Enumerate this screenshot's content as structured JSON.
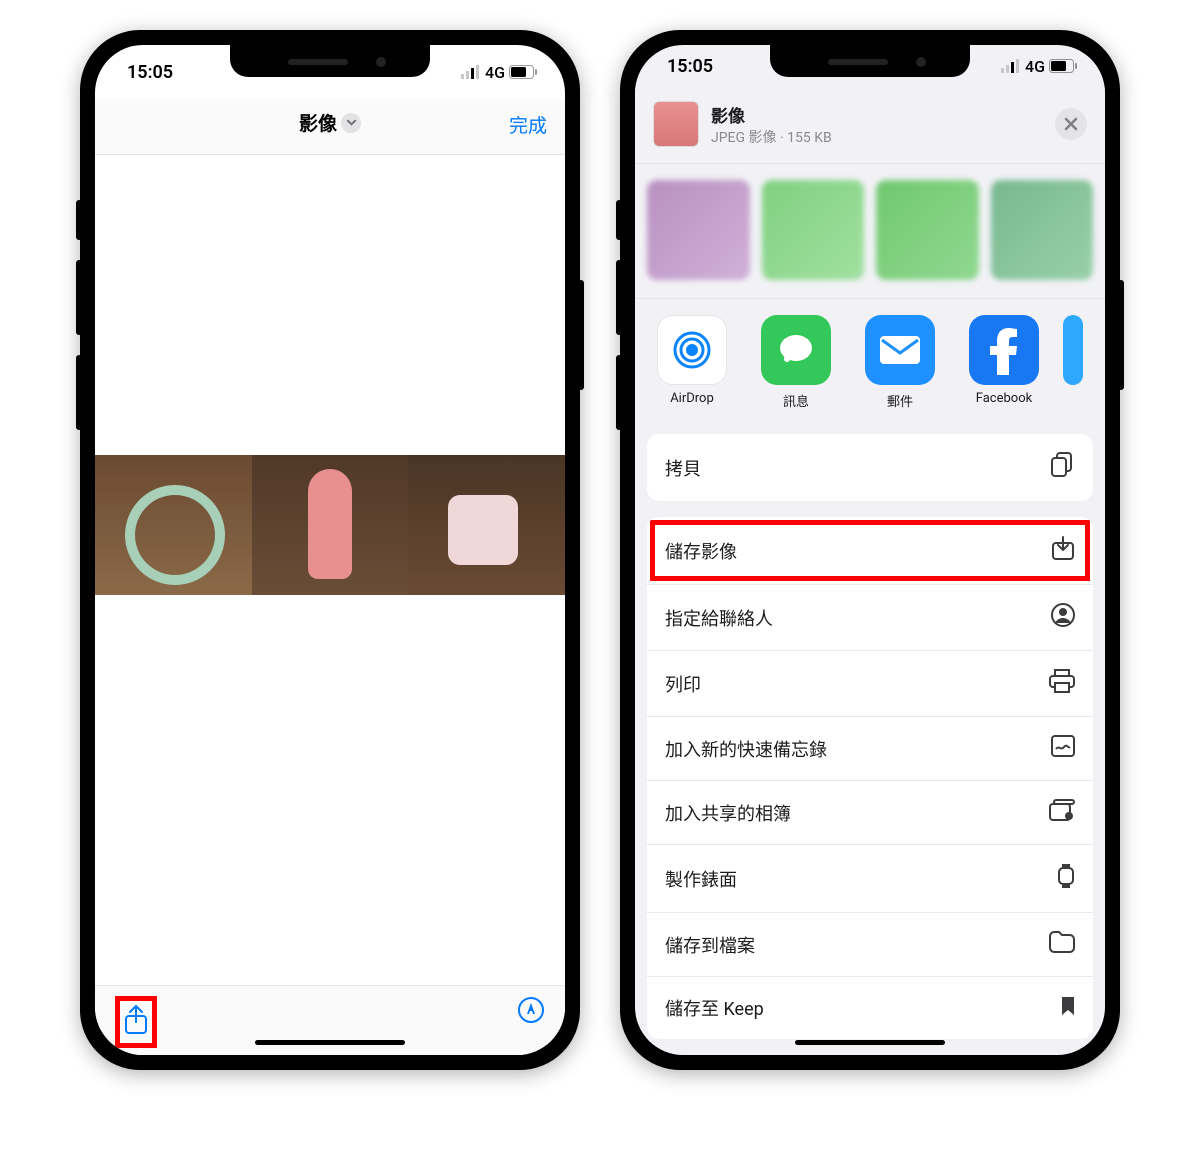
{
  "status": {
    "time": "15:05",
    "network": "4G"
  },
  "phone1": {
    "title": "影像",
    "done": "完成"
  },
  "phone2": {
    "sheet": {
      "title": "影像",
      "subtitle": "JPEG 影像 · 155 KB"
    },
    "apps": [
      {
        "label": "AirDrop"
      },
      {
        "label": "訊息"
      },
      {
        "label": "郵件"
      },
      {
        "label": "Facebook"
      }
    ],
    "actions": {
      "copy": "拷貝",
      "save_image": "儲存影像",
      "assign_contact": "指定給聯絡人",
      "print": "列印",
      "quick_note": "加入新的快速備忘錄",
      "shared_album": "加入共享的相簿",
      "watch_face": "製作錶面",
      "save_files": "儲存到檔案",
      "save_keep": "儲存至 Keep"
    }
  }
}
